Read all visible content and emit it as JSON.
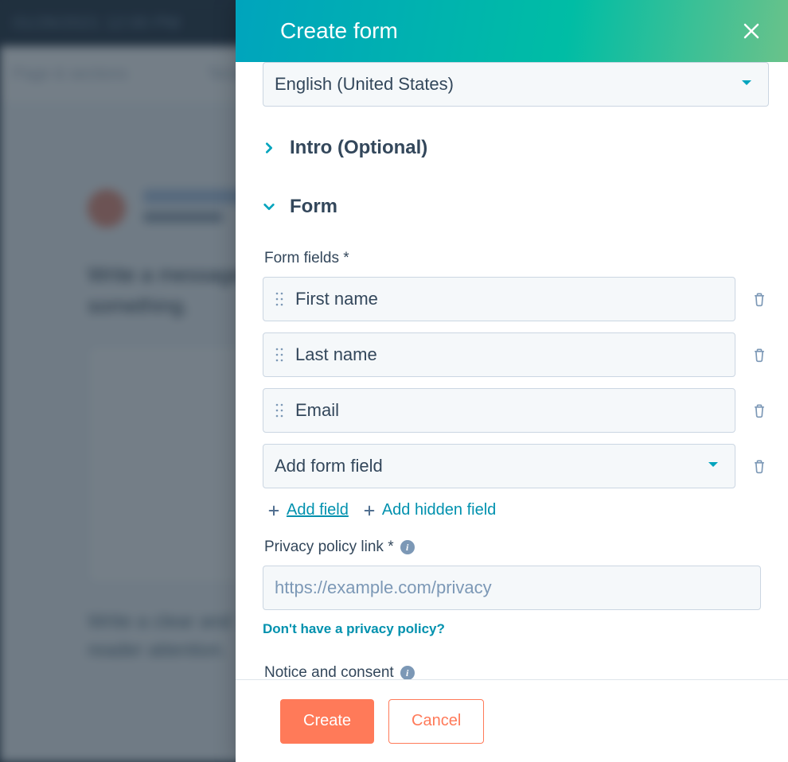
{
  "background": {
    "topbar_text": "01/26/2021 12:00 PM",
    "subbar_left": "Page & sections",
    "subbar_right": "Templates",
    "prompt_line1": "Write a message that",
    "prompt_line2": "something.",
    "caption_line1": "Write a clear and",
    "caption_line2": "reader attention."
  },
  "panel": {
    "title": "Create form"
  },
  "language": {
    "selected": "English (United States)"
  },
  "sections": {
    "intro_label": "Intro (Optional)",
    "form_label": "Form"
  },
  "form": {
    "fields_label": "Form fields *",
    "fields": [
      {
        "name": "First name"
      },
      {
        "name": "Last name"
      },
      {
        "name": "Email"
      }
    ],
    "add_field_placeholder": "Add form field",
    "add_field_link": "Add field",
    "add_hidden_field_link": "Add hidden field"
  },
  "privacy": {
    "label": "Privacy policy link *",
    "placeholder": "https://example.com/privacy",
    "help_link": "Don't have a privacy policy?"
  },
  "notice": {
    "label": "Notice and consent"
  },
  "footer": {
    "create": "Create",
    "cancel": "Cancel"
  }
}
